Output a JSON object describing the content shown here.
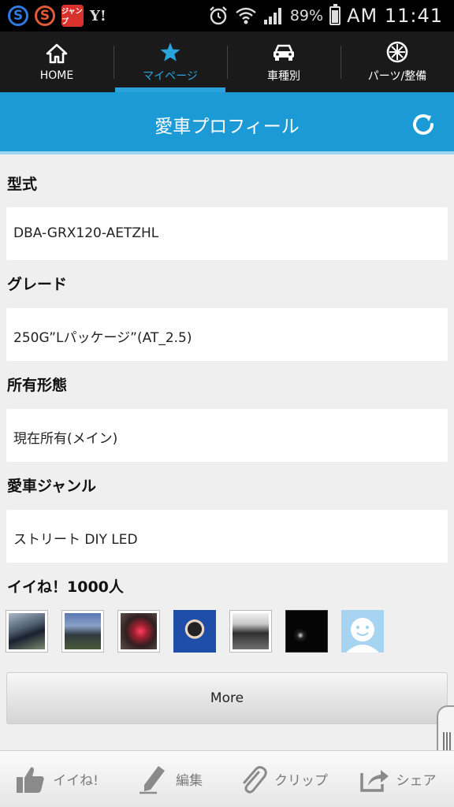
{
  "status_bar": {
    "apps": [
      "S",
      "S",
      "ジャンプ",
      "Y!"
    ],
    "battery_percent": "89%",
    "battery_level": 0.89,
    "clock": "AM 11:41"
  },
  "nav": {
    "items": [
      {
        "label": "HOME",
        "icon": "home-icon",
        "active": false
      },
      {
        "label": "マイページ",
        "icon": "star-icon",
        "active": true
      },
      {
        "label": "車種別",
        "icon": "car-icon",
        "active": false
      },
      {
        "label": "パーツ/整備",
        "icon": "wheel-icon",
        "active": false
      }
    ]
  },
  "header": {
    "title": "愛車プロフィール",
    "refresh_icon": "refresh-icon"
  },
  "profile": {
    "model_label": "型式",
    "model_value": "DBA-GRX120-AETZHL",
    "grade_label": "グレード",
    "grade_value": "250G”Lパッケージ”(AT_2.5)",
    "ownership_label": "所有形態",
    "ownership_value": "現在所有(メイン)",
    "genre_label": "愛車ジャンル",
    "genre_value": "ストリート DIY LED"
  },
  "likes": {
    "title": "イイね！1000人",
    "more_label": "More"
  },
  "toolbar": {
    "like_label": "イイね!",
    "edit_label": "編集",
    "clip_label": "クリップ",
    "share_label": "シェア"
  },
  "colors": {
    "accent": "#1c9ad6",
    "nav_bg": "#1a1a1a",
    "active_tab": "#2aa3dc"
  }
}
